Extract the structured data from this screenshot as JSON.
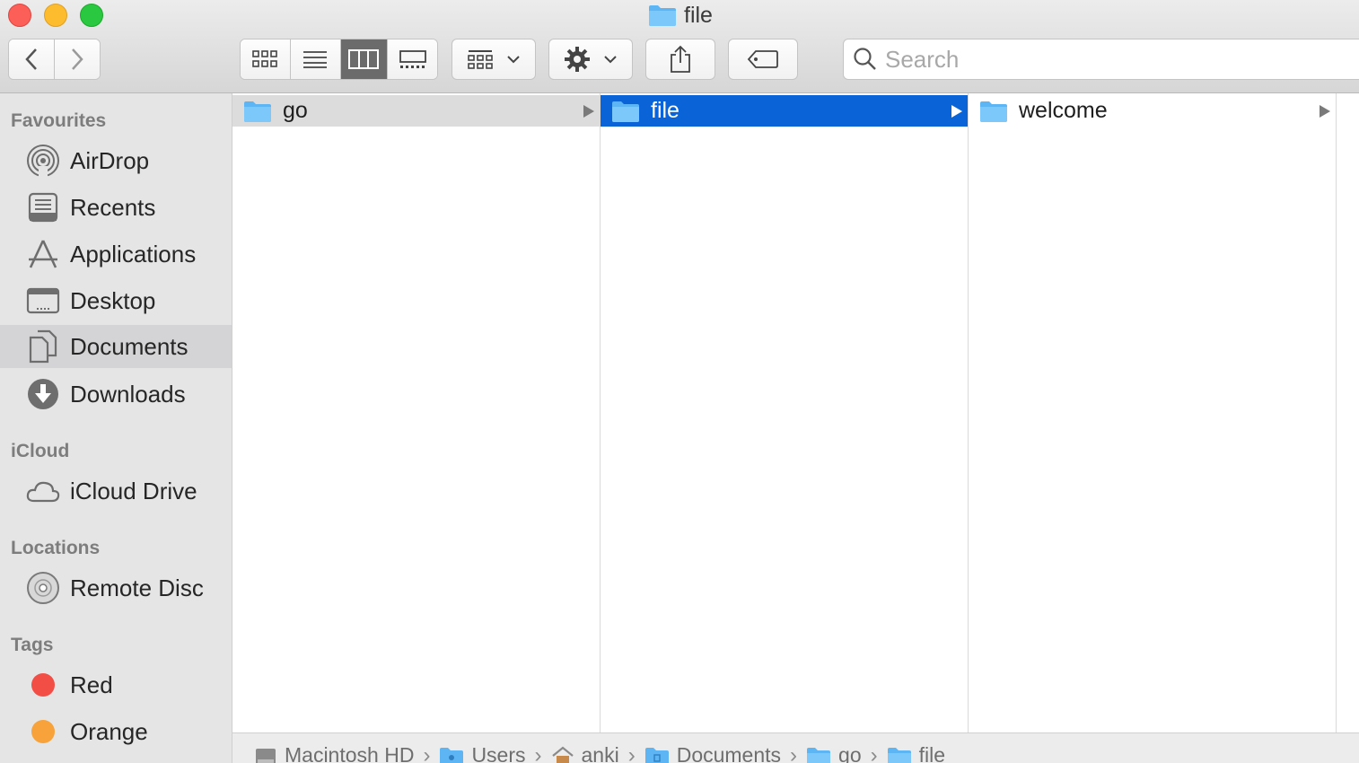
{
  "window": {
    "title": "file"
  },
  "toolbar": {
    "back_icon": "chevron-left-icon",
    "forward_icon": "chevron-right-icon",
    "views": [
      "icon-view",
      "list-view",
      "column-view",
      "gallery-view"
    ],
    "active_view": "column-view",
    "search": {
      "placeholder": "Search",
      "value": ""
    }
  },
  "sidebar": {
    "sections": [
      {
        "heading": "Favourites",
        "items": [
          {
            "label": "AirDrop",
            "icon": "airdrop-icon"
          },
          {
            "label": "Recents",
            "icon": "recents-icon"
          },
          {
            "label": "Applications",
            "icon": "applications-icon"
          },
          {
            "label": "Desktop",
            "icon": "desktop-icon"
          },
          {
            "label": "Documents",
            "icon": "documents-icon",
            "selected": true
          },
          {
            "label": "Downloads",
            "icon": "downloads-icon"
          }
        ]
      },
      {
        "heading": "iCloud",
        "items": [
          {
            "label": "iCloud Drive",
            "icon": "cloud-icon"
          }
        ]
      },
      {
        "heading": "Locations",
        "items": [
          {
            "label": "Remote Disc",
            "icon": "disc-icon"
          }
        ]
      },
      {
        "heading": "Tags",
        "items": [
          {
            "label": "Red",
            "color": "#f24e45"
          },
          {
            "label": "Orange",
            "color": "#f7a23a"
          }
        ]
      }
    ]
  },
  "columns": [
    {
      "items": [
        {
          "name": "go",
          "kind": "folder",
          "selected": "inactive"
        }
      ]
    },
    {
      "items": [
        {
          "name": "file",
          "kind": "folder",
          "selected": "active"
        }
      ]
    },
    {
      "items": [
        {
          "name": "welcome",
          "kind": "folder"
        }
      ]
    }
  ],
  "pathbar": {
    "segments": [
      {
        "label": "Macintosh HD",
        "icon": "hard-drive-icon"
      },
      {
        "label": "Users",
        "icon": "users-folder-icon"
      },
      {
        "label": "anki",
        "icon": "home-icon"
      },
      {
        "label": "Documents",
        "icon": "documents-folder-icon"
      },
      {
        "label": "go",
        "icon": "folder-icon"
      },
      {
        "label": "file",
        "icon": "folder-icon"
      }
    ]
  },
  "colors": {
    "selection_active": "#0a64d8",
    "selection_inactive": "#dcdcdc",
    "sidebar_bg": "#e6e5e6",
    "folder_blue": "#5db6f3"
  }
}
